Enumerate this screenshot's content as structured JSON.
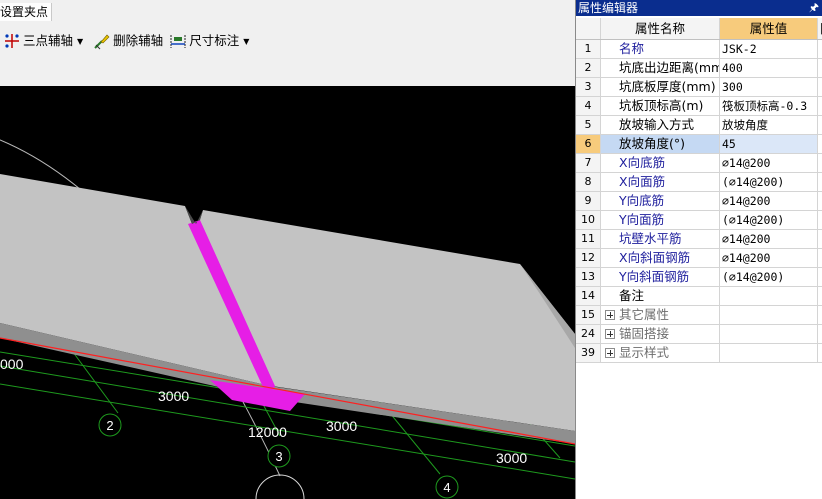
{
  "toolbar": {
    "tab_label": "设置夹点",
    "buttons": [
      {
        "label": "三点辅轴",
        "icon": "three-point-axis-icon"
      },
      {
        "label": "删除辅轴",
        "icon": "delete-axis-icon"
      },
      {
        "label": "尺寸标注",
        "icon": "dimension-icon"
      }
    ]
  },
  "canvas": {
    "dimensions": [
      "3000",
      "12000",
      "3000",
      "3000",
      "000"
    ],
    "axis_labels": [
      "2",
      "3",
      "4"
    ]
  },
  "property_editor": {
    "title": "属性编辑器",
    "pin_icon": "pin-icon",
    "headers": {
      "name": "属性名称",
      "value": "属性值",
      "extra": "附"
    },
    "rows": [
      {
        "num": "1",
        "name": "名称",
        "value": "JSK-2"
      },
      {
        "num": "2",
        "name": "坑底出边距离(mm)",
        "value": "400"
      },
      {
        "num": "3",
        "name": "坑底板厚度(mm)",
        "value": "300"
      },
      {
        "num": "4",
        "name": "坑板顶标高(m)",
        "value": "筏板顶标高-0.3"
      },
      {
        "num": "5",
        "name": "放坡输入方式",
        "value": "放坡角度"
      },
      {
        "num": "6",
        "name": "放坡角度(°)",
        "value": "45"
      },
      {
        "num": "7",
        "name": "X向底筋",
        "value": "⌀14@200"
      },
      {
        "num": "8",
        "name": "X向面筋",
        "value": "(⌀14@200)"
      },
      {
        "num": "9",
        "name": "Y向底筋",
        "value": "⌀14@200"
      },
      {
        "num": "10",
        "name": "Y向面筋",
        "value": "(⌀14@200)"
      },
      {
        "num": "11",
        "name": "坑壁水平筋",
        "value": "⌀14@200"
      },
      {
        "num": "12",
        "name": "X向斜面钢筋",
        "value": "⌀14@200"
      },
      {
        "num": "13",
        "name": "Y向斜面钢筋",
        "value": "(⌀14@200)"
      },
      {
        "num": "14",
        "name": "备注",
        "value": ""
      }
    ],
    "groups": [
      {
        "num": "15",
        "name": "其它属性"
      },
      {
        "num": "24",
        "name": "锚固搭接"
      },
      {
        "num": "39",
        "name": "显示样式"
      }
    ]
  },
  "colors": {
    "title_bar": "#0a2d8e",
    "header_value": "#f7cb7c",
    "selected_row": "#c5d9f3",
    "slab": "#c3c3c3",
    "pit": "#e61ee6",
    "axis_line": "#1e9a1e",
    "edge_line": "#ff2020"
  }
}
